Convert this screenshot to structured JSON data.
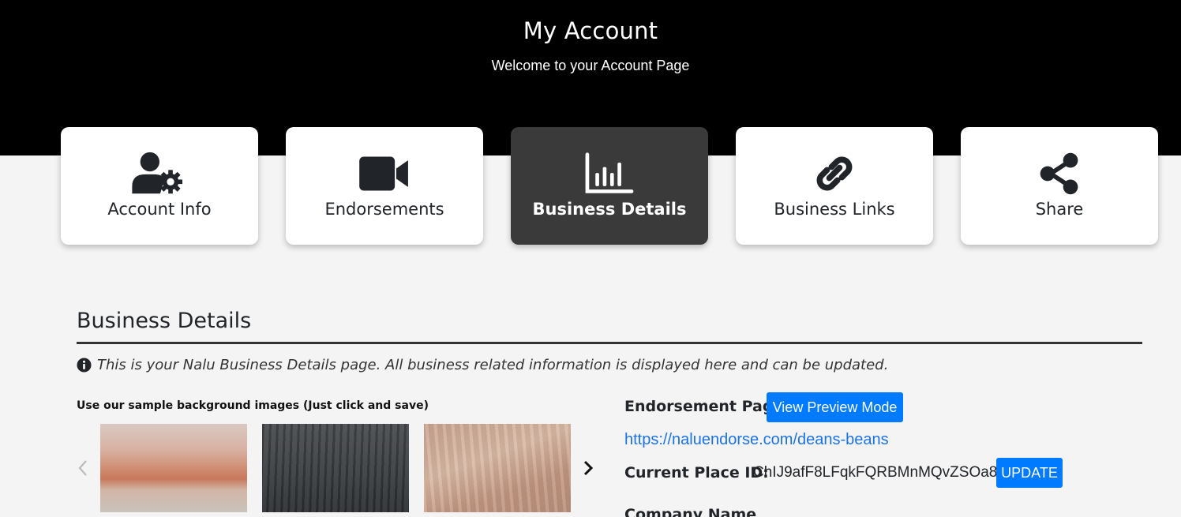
{
  "header": {
    "title": "My Account",
    "subtitle": "Welcome to your Account Page"
  },
  "nav_cards": [
    {
      "label": "Account Info",
      "icon": "user-gear-icon",
      "active": false
    },
    {
      "label": "Endorsements",
      "icon": "video-camera-icon",
      "active": false
    },
    {
      "label": "Business Details",
      "icon": "bar-chart-icon",
      "active": true
    },
    {
      "label": "Business Links",
      "icon": "link-icon",
      "active": false
    },
    {
      "label": "Share",
      "icon": "share-icon",
      "active": false
    }
  ],
  "section": {
    "title": "Business Details",
    "info": "This is your Nalu Business Details page. All business related information is displayed here and can be updated."
  },
  "samples": {
    "label": "Use our sample background images (Just click and save)"
  },
  "endorsement": {
    "label": "Endorsement Page",
    "preview_button": "View Preview Mode",
    "link": "https://naluendorse.com/deans-beans",
    "place_label": "Current Place ID:",
    "place_id": "ChIJ9afF8LFqkFQRBMnMQvZSOa8",
    "update_button": "UPDATE",
    "company_label": "Company Name"
  },
  "colors": {
    "header_bg": "#000000",
    "page_bg": "#f4f4f4",
    "active_card": "#3a3a3a",
    "primary_button": "#007bff",
    "link": "#1a73e8"
  }
}
